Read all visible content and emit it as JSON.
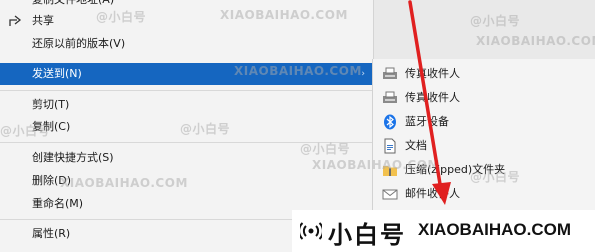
{
  "context_menu": {
    "items": [
      {
        "label": "复制文件地址(A)",
        "icon": "copy-path-icon"
      },
      {
        "label": "共享",
        "icon": "share-icon"
      },
      {
        "label": "还原以前的版本(V)",
        "icon": ""
      },
      {
        "label": "发送到(N)",
        "icon": "",
        "highlighted": true,
        "submenu": true
      },
      {
        "label": "剪切(T)",
        "icon": ""
      },
      {
        "label": "复制(C)",
        "icon": ""
      },
      {
        "label": "创建快捷方式(S)",
        "icon": ""
      },
      {
        "label": "删除(D)",
        "icon": ""
      },
      {
        "label": "重命名(M)",
        "icon": ""
      },
      {
        "label": "属性(R)",
        "icon": ""
      }
    ],
    "highlight_color": "#1566c0"
  },
  "send_to_submenu": {
    "items": [
      {
        "label": "传真收件人",
        "icon": "fax-icon"
      },
      {
        "label": "传真收件人",
        "icon": "fax-icon"
      },
      {
        "label": "蓝牙设备",
        "icon": "bluetooth-icon"
      },
      {
        "label": "文档",
        "icon": "document-icon"
      },
      {
        "label": "压缩(zipped)文件夹",
        "icon": "zip-folder-icon"
      },
      {
        "label": "邮件收件人",
        "icon": "mail-recipient-icon"
      }
    ]
  },
  "watermark": {
    "cn": "@小白号",
    "en": "XIAOBAIHAO.COM"
  },
  "footer": {
    "brand_cn": "小白号",
    "brand_en": "XIAOBAIHAO.COM"
  },
  "colors": {
    "arrow": "#e02020",
    "bluetooth": "#1a73e8"
  }
}
